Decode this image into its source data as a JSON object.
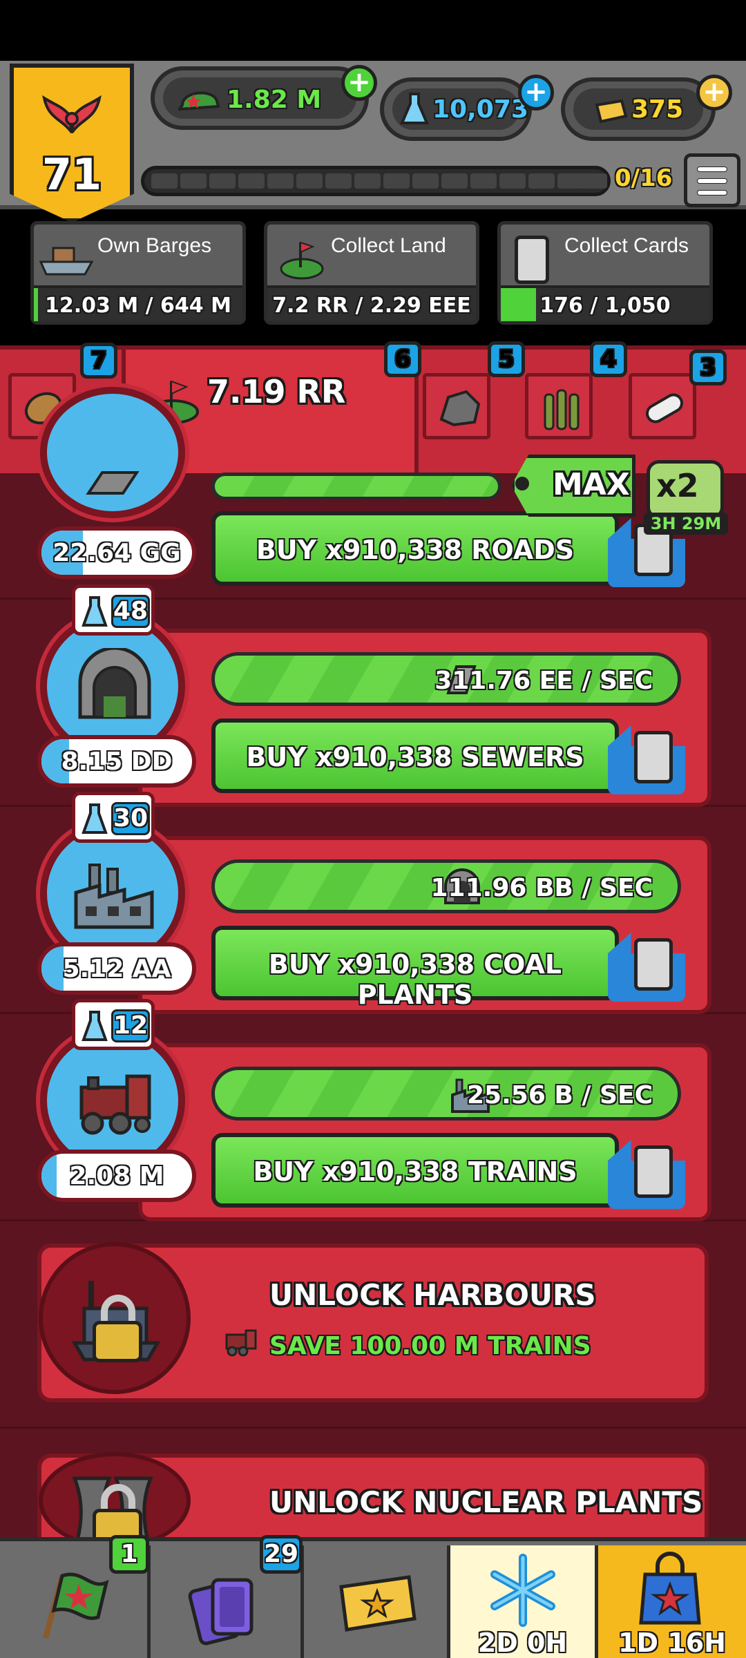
{
  "hud": {
    "rank_level": "71",
    "cash": "1.82 M",
    "science": "10,073",
    "gold": "375",
    "progress_label": "0/16"
  },
  "goals": [
    {
      "title": "Own Barges",
      "value": "12.03 M / 644 M",
      "progress": 0.02
    },
    {
      "title": "Collect Land",
      "value": "7.2 RR / 2.29 EEE",
      "progress": 0.0
    },
    {
      "title": "Collect Cards",
      "value": "176 / 1,050",
      "progress": 0.17
    }
  ],
  "tabs": {
    "potato_badge": "7",
    "land_value": "7.19 RR",
    "land_badge": "6",
    "stone_badge": "5",
    "ammo_badge": "4",
    "pill_badge": "3"
  },
  "multiplier": {
    "max_label": "MAX",
    "boost_label": "x2",
    "boost_timer": "3H 29M"
  },
  "production": [
    {
      "id": "roads",
      "price": "22.64 GG",
      "buy_label": "BUY x910,338 ROADS"
    },
    {
      "id": "sewers",
      "level": "48",
      "price": "8.15 DD",
      "rate": "311.76 EE / SEC",
      "buy_label": "BUY x910,338 SEWERS"
    },
    {
      "id": "coal-plants",
      "level": "30",
      "price": "5.12 AA",
      "rate": "111.96 BB / SEC",
      "buy_label": "BUY x910,338 COAL PLANTS"
    },
    {
      "id": "trains",
      "level": "12",
      "price": "2.08 M",
      "rate": "25.56 B / SEC",
      "buy_label": "BUY x910,338 TRAINS"
    }
  ],
  "unlocks": [
    {
      "title": "UNLOCK HARBOURS",
      "condition": "SAVE 100.00 M TRAINS"
    },
    {
      "title": "UNLOCK NUCLEAR PLANTS"
    }
  ],
  "bottom_nav": {
    "flag_badge": "1",
    "cards_badge": "29",
    "freeze_label": "2D 0H",
    "shop_label": "1D 16H"
  },
  "colors": {
    "accent_red": "#d3303f",
    "button_green": "#6bd84a",
    "badge_blue": "#1ca3e6",
    "gold": "#f7b81c"
  }
}
